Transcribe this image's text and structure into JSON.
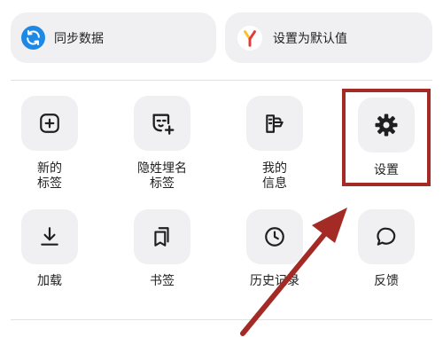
{
  "top_actions": [
    {
      "label": "同步数据",
      "icon": "sync-icon",
      "color": "#1e88e5"
    },
    {
      "label": "设置为默认值",
      "icon": "yandex-y-icon",
      "color": "#e53935"
    }
  ],
  "grid": [
    {
      "line1": "新的",
      "line2": "标签",
      "icon": "plus-square-icon"
    },
    {
      "line1": "隐姓埋名",
      "line2": "标签",
      "icon": "incognito-mask-icon"
    },
    {
      "line1": "我的",
      "line2": "信息",
      "icon": "id-card-icon"
    },
    {
      "line1": "设置",
      "line2": "",
      "icon": "gear-icon"
    },
    {
      "line1": "加载",
      "line2": "",
      "icon": "download-icon"
    },
    {
      "line1": "书签",
      "line2": "",
      "icon": "bookmarks-icon"
    },
    {
      "line1": "历史记录",
      "line2": "",
      "icon": "clock-icon"
    },
    {
      "line1": "反馈",
      "line2": "",
      "icon": "speech-bubble-icon"
    }
  ],
  "annotation": {
    "color": "#a42a26",
    "target": "设置"
  }
}
